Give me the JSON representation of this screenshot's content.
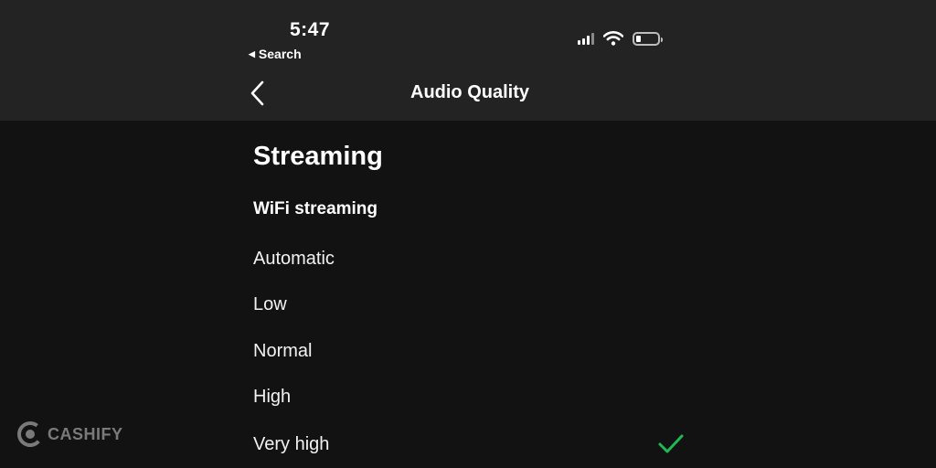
{
  "status_bar": {
    "time": "5:47",
    "back_label": "Search"
  },
  "header": {
    "title": "Audio Quality"
  },
  "section": {
    "title": "Streaming",
    "group_title": "WiFi streaming",
    "options": [
      {
        "label": "Automatic",
        "selected": false
      },
      {
        "label": "Low",
        "selected": false
      },
      {
        "label": "Normal",
        "selected": false
      },
      {
        "label": "High",
        "selected": false
      },
      {
        "label": "Very high",
        "selected": true
      }
    ]
  },
  "watermark": {
    "text": "CASHIFY"
  },
  "colors": {
    "background": "#121212",
    "header_background": "#232323",
    "accent_check": "#1DB954"
  },
  "icons": {
    "signal": "cellular-signal-icon",
    "wifi": "wifi-icon",
    "battery": "battery-icon",
    "back": "chevron-left-icon",
    "selected": "checkmark-icon"
  }
}
